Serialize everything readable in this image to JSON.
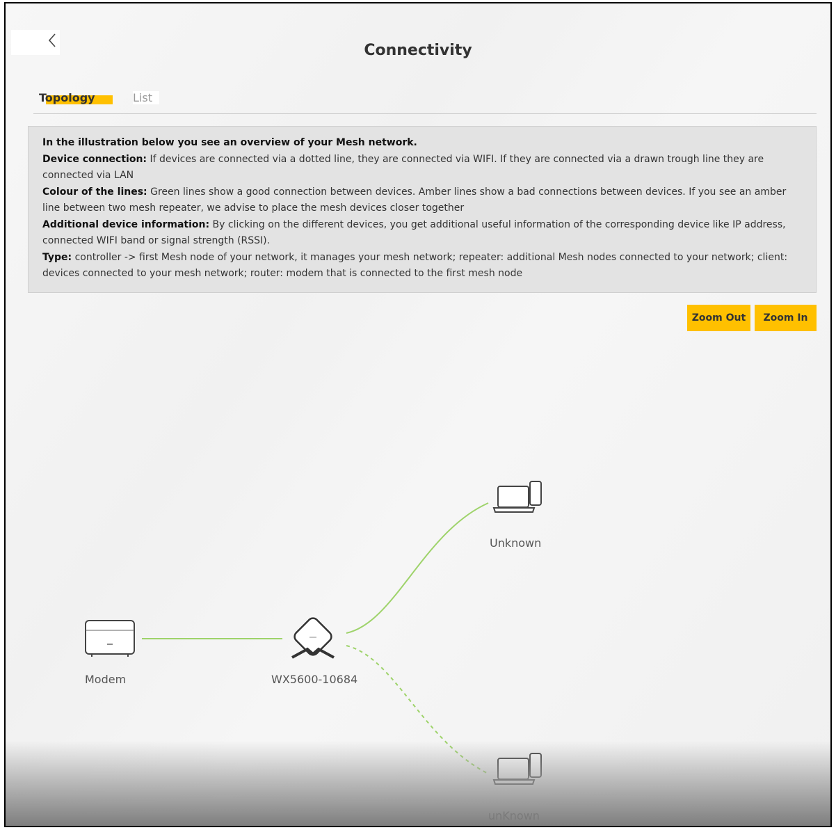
{
  "header": {
    "title": "Connectivity"
  },
  "tabs": [
    {
      "label": "Topology",
      "active": true
    },
    {
      "label": "List",
      "active": false
    }
  ],
  "info": {
    "intro": "In the illustration below you see an overview of your Mesh network.",
    "device_connection": {
      "heading": "Device connection:",
      "text": " If devices are connected via a dotted line, they are connected via WIFI. If they are connected via a drawn trough line they are connected via LAN"
    },
    "colour": {
      "heading": "Colour of the lines:",
      "text": " Green lines show a good connection between devices. Amber lines show a bad connections between devices. If you see an amber line between two mesh repeater, we advise to place the mesh devices closer together"
    },
    "additional": {
      "heading": "Additional device information:",
      "text": " By clicking on the different devices, you get additional useful information of the corresponding device like IP address, connected WIFI band or signal strength (RSSI)."
    },
    "type": {
      "heading": "Type:",
      "text": " controller -> first Mesh node of your network, it manages your mesh network; repeater: additional Mesh nodes connected to your network; client: devices connected to your mesh network; router: modem that is connected to the first mesh node"
    }
  },
  "zoom": {
    "out_label": "Zoom Out",
    "in_label": "Zoom In"
  },
  "topology": {
    "nodes": [
      {
        "id": "modem",
        "label": "Modem",
        "icon": "modem-icon"
      },
      {
        "id": "controller",
        "label": "WX5600-10684",
        "icon": "mesh-router-icon"
      },
      {
        "id": "client1",
        "label": "Unknown",
        "icon": "laptop-phone-icon"
      },
      {
        "id": "client2",
        "label": "unKnown",
        "icon": "laptop-phone-icon"
      }
    ],
    "links": [
      {
        "from": "modem",
        "to": "controller",
        "style": "solid"
      },
      {
        "from": "controller",
        "to": "client1",
        "style": "solid"
      },
      {
        "from": "controller",
        "to": "client2",
        "style": "dotted"
      }
    ]
  },
  "colors": {
    "accent": "#ffc000",
    "good_link": "#9ed36a",
    "info_bg": "#e3e3e3"
  }
}
